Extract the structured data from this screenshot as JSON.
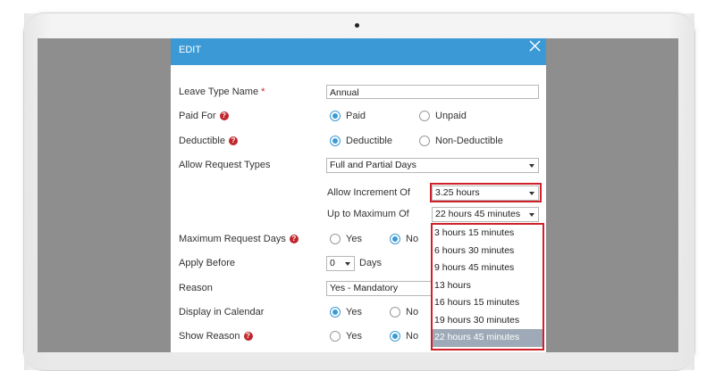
{
  "modal": {
    "title": "EDIT"
  },
  "leave_type": {
    "label": "Leave Type Name",
    "required_mark": "*",
    "value": "Annual"
  },
  "paid_for": {
    "label": "Paid For",
    "options": [
      "Paid",
      "Unpaid"
    ],
    "selected": "Paid"
  },
  "deductible": {
    "label": "Deductible",
    "options": [
      "Deductible",
      "Non-Deductible"
    ],
    "selected": "Deductible"
  },
  "request_types": {
    "label": "Allow Request Types",
    "value": "Full and Partial Days"
  },
  "increment": {
    "label": "Allow Increment Of",
    "value": "3.25 hours"
  },
  "maximum": {
    "label": "Up to Maximum Of",
    "value": "22 hours 45 minutes"
  },
  "max_request_days": {
    "label": "Maximum Request Days",
    "options": [
      "Yes",
      "No"
    ],
    "selected": "No"
  },
  "apply_before": {
    "label": "Apply Before",
    "value": "0",
    "unit": "Days"
  },
  "reason": {
    "label": "Reason",
    "value": "Yes - Mandatory"
  },
  "display_calendar": {
    "label": "Display in Calendar",
    "options": [
      "Yes",
      "No"
    ],
    "selected": "Yes"
  },
  "show_reason": {
    "label": "Show Reason",
    "options": [
      "Yes",
      "No"
    ],
    "selected": "No"
  },
  "help_glyph": "?",
  "dropdown_options": [
    "3 hours 15 minutes",
    "6 hours 30 minutes",
    "9 hours 45 minutes",
    "13 hours",
    "16 hours 15 minutes",
    "19 hours 30 minutes",
    "22 hours 45 minutes"
  ],
  "dropdown_selected_index": 6,
  "colors": {
    "header": "#3b9ad6",
    "highlight": "#d0212a",
    "radio_on": "#3b9ad6",
    "selected_item": "#9eaab7"
  }
}
